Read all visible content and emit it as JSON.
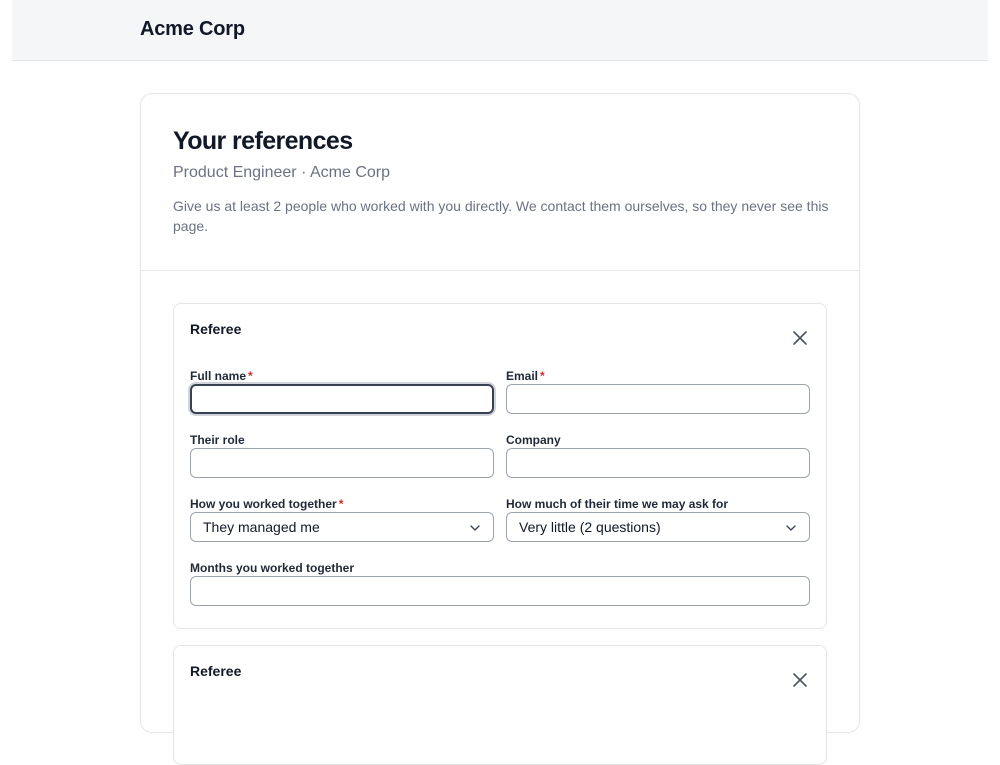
{
  "header": {
    "brand": "Acme Corp"
  },
  "page": {
    "title": "Your references",
    "subtitle": "Product Engineer · Acme Corp",
    "intro": "Give us at least 2 people who worked with you directly. We contact them ourselves, so they never see this page."
  },
  "referees": [
    {
      "title": "Referee",
      "fields": {
        "full_name": {
          "label": "Full name",
          "required": "*",
          "value": ""
        },
        "email": {
          "label": "Email",
          "required": "*",
          "value": ""
        },
        "role": {
          "label": "Their role",
          "value": ""
        },
        "company": {
          "label": "Company",
          "value": ""
        },
        "relationship": {
          "label": "How you worked together",
          "required": "*",
          "selected": "They managed me"
        },
        "time_ask": {
          "label": "How much of their time we may ask for",
          "selected": "Very little (2 questions)"
        },
        "months": {
          "label": "Months you worked together",
          "value": ""
        }
      }
    },
    {
      "title": "Referee"
    }
  ],
  "icons": {
    "remove": "close-icon",
    "dropdown": "chevron-down-icon"
  }
}
